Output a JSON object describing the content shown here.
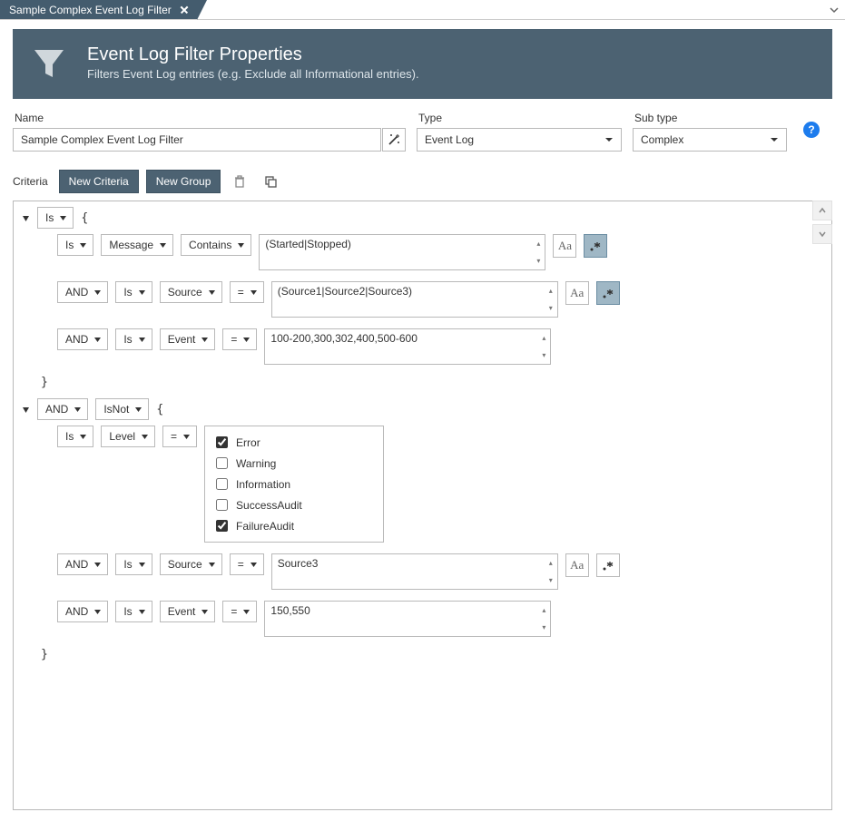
{
  "tab": {
    "title": "Sample Complex Event Log Filter"
  },
  "banner": {
    "title": "Event Log Filter Properties",
    "subtitle": "Filters Event Log entries (e.g. Exclude all Informational entries)."
  },
  "labels": {
    "name": "Name",
    "type": "Type",
    "subtype": "Sub type",
    "criteria": "Criteria"
  },
  "buttons": {
    "new_criteria": "New Criteria",
    "new_group": "New Group"
  },
  "form": {
    "name": "Sample Complex Event Log Filter",
    "type": "Event Log",
    "subtype": "Complex"
  },
  "ops": {
    "is": "Is",
    "isnot": "IsNot",
    "and": "AND",
    "eq": "=",
    "contains": "Contains"
  },
  "fields": {
    "message": "Message",
    "source": "Source",
    "event": "Event",
    "level": "Level"
  },
  "group1": {
    "r1_value": "(Started|Stopped)",
    "r2_value": "(Source1|Source2|Source3)",
    "r3_value": "100-200,300,302,400,500-600"
  },
  "group2": {
    "levels": {
      "error": {
        "label": "Error",
        "checked": true
      },
      "warning": {
        "label": "Warning",
        "checked": false
      },
      "information": {
        "label": "Information",
        "checked": false
      },
      "success_audit": {
        "label": "SuccessAudit",
        "checked": false
      },
      "failure_audit": {
        "label": "FailureAudit",
        "checked": true
      }
    },
    "r2_value": "Source3",
    "r3_value": "150,550"
  },
  "icons": {
    "case_sensitive": "Aa",
    "regex": "✱"
  }
}
